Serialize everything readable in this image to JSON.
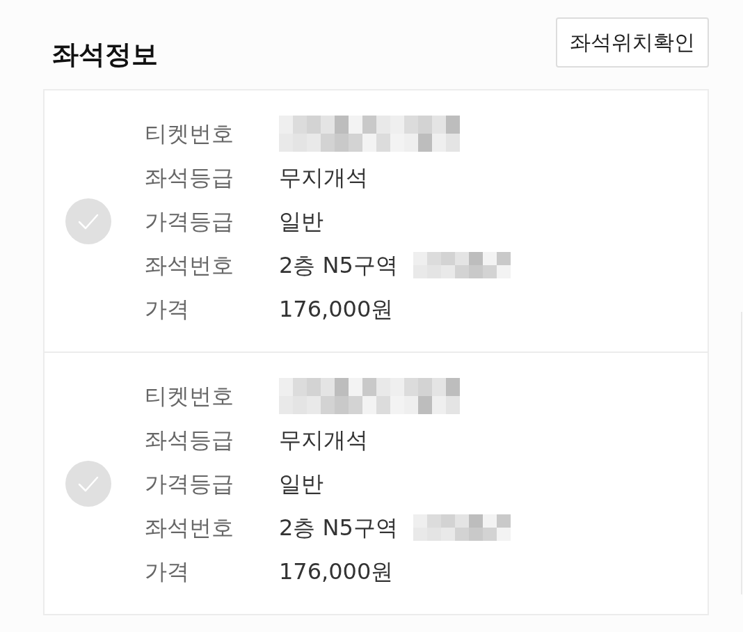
{
  "header": {
    "title": "좌석정보",
    "location_button": "좌석위치확인"
  },
  "tickets": [
    {
      "selected": false,
      "fields": [
        {
          "kind": "redacted",
          "label": "티켓번호"
        },
        {
          "kind": "text",
          "label": "좌석등급",
          "value": "무지개석"
        },
        {
          "kind": "text",
          "label": "가격등급",
          "value": "일반"
        },
        {
          "kind": "text_redacted",
          "label": "좌석번호",
          "value": "2층 N5구역"
        },
        {
          "kind": "text",
          "label": "가격",
          "value": "176,000원"
        }
      ]
    },
    {
      "selected": false,
      "fields": [
        {
          "kind": "redacted",
          "label": "티켓번호"
        },
        {
          "kind": "text",
          "label": "좌석등급",
          "value": "무지개석"
        },
        {
          "kind": "text",
          "label": "가격등급",
          "value": "일반"
        },
        {
          "kind": "text_redacted",
          "label": "좌석번호",
          "value": "2층 N5구역"
        },
        {
          "kind": "text",
          "label": "가격",
          "value": "176,000원"
        }
      ]
    }
  ]
}
